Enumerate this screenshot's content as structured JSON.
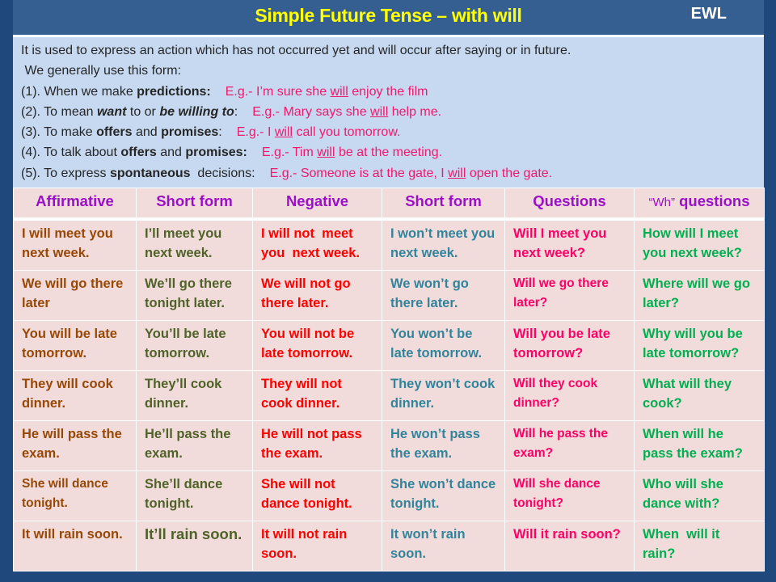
{
  "header": {
    "title": "Simple Future Tense – with will",
    "brand": "EWL"
  },
  "intro": {
    "line1": "It is used to express an action which has not occurred yet and will occur after saying or in future.",
    "line2": " We generally use this form:",
    "uses": [
      {
        "prefix": "(1). When we make ",
        "bold1": "predictions:",
        "mid": "",
        "bold2": "",
        "suffix": "",
        "ex_pre": "E.g.- I’m sure she ",
        "ex_will": "will",
        "ex_post": " enjoy the film"
      },
      {
        "prefix": "(2). To mean ",
        "bold1": "want",
        "mid": " to or ",
        "bold2": "be willing to",
        "suffix": ":",
        "ex_pre": "E.g.- Mary says she ",
        "ex_will": "will",
        "ex_post": " help me."
      },
      {
        "prefix": "(3). To make ",
        "bold1": "offers",
        "mid": " and ",
        "bold2": "promises",
        "suffix": ":",
        "ex_pre": "E.g.- I ",
        "ex_will": "will",
        "ex_post": " call you tomorrow."
      },
      {
        "prefix": "(4). To talk about ",
        "bold1": "offers",
        "mid": " and ",
        "bold2": "promises:",
        "suffix": "",
        "ex_pre": "E.g.- Tim ",
        "ex_will": "will",
        "ex_post": " be at the meeting."
      },
      {
        "prefix": "(5). To express ",
        "bold1": "spontaneous",
        "mid": "  decisions:",
        "bold2": "",
        "suffix": "",
        "ex_pre": "E.g.- Someone is at the gate, I ",
        "ex_will": "will",
        "ex_post": " open the gate."
      }
    ]
  },
  "table": {
    "headers": [
      "Affirmative",
      "Short form",
      "Negative",
      "Short form",
      "Questions",
      "“Wh”",
      "questions"
    ],
    "rows": [
      [
        "I will meet you next week.",
        "I’ll meet you next week.",
        "I will not  meet you  next week.",
        "I won’t meet you next week.",
        "Will I meet you next week?",
        "How will I meet you next week?"
      ],
      [
        "We will go there later",
        "We’ll go there tonight later.",
        "We will not go there later.",
        "We won’t go there later.",
        "Will we go there later?",
        "Where will we go later?"
      ],
      [
        "You will be late tomorrow.",
        "You’ll be late tomorrow.",
        "You will not be late tomorrow.",
        "You won’t be late tomorrow.",
        "Will you be late tomorrow?",
        "Why will you be late tomorrow?"
      ],
      [
        "They will cook dinner.",
        "They’ll cook dinner.",
        "They will not cook dinner.",
        "They won’t cook dinner.",
        "Will they cook dinner?",
        "What will they cook?"
      ],
      [
        "He will pass the exam.",
        "He’ll pass the exam.",
        "He will not pass the exam.",
        "He won’t pass the exam.",
        "Will he pass the exam?",
        "When will he pass the exam?"
      ],
      [
        "She will dance tonight.",
        "She’ll dance tonight.",
        "She will not dance tonight.",
        "She won’t dance tonight.",
        "Will she dance tonight?",
        "Who will she dance with?"
      ],
      [
        "It will rain soon.",
        "It’ll rain soon.",
        "It will not rain soon.",
        "It won’t rain soon.",
        "Will it rain soon?",
        "When  will it rain?"
      ]
    ]
  }
}
